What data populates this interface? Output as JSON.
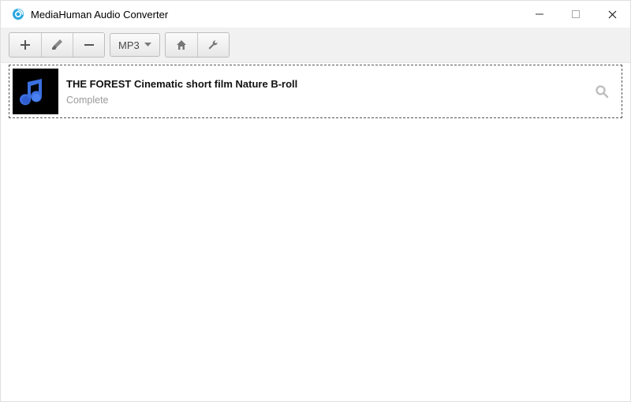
{
  "window": {
    "title": "MediaHuman Audio Converter"
  },
  "toolbar": {
    "format_label": "MP3"
  },
  "items": [
    {
      "title": "THE FOREST Cinematic short film Nature B-roll",
      "status": "Complete"
    }
  ]
}
